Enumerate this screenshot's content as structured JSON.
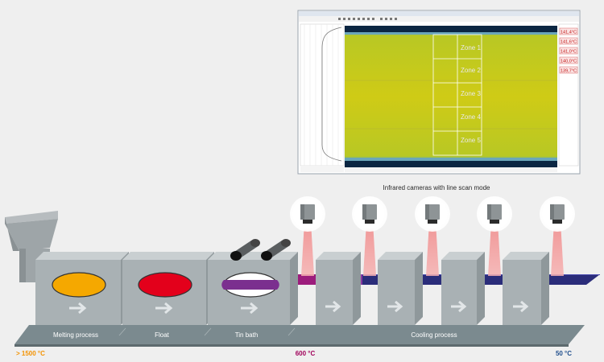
{
  "screen": {
    "zones": [
      "Zone 1",
      "Zone 2",
      "Zone 3",
      "Zone 4",
      "Zone 5"
    ],
    "readouts": [
      "141,4°C",
      "141,6°C",
      "141,0°C",
      "140,0°C",
      "139,7°C"
    ]
  },
  "caption": "Infrared cameras  with line scan mode",
  "stages": {
    "melting": "Melting process",
    "float": "Float",
    "tin": "Tin bath",
    "cooling": "Cooling  process"
  },
  "temps": {
    "hot": "> 1500 °C",
    "mid": "600 °C",
    "cold": "50 °C"
  },
  "colors": {
    "melt": "#f5a800",
    "float": "#e3001b",
    "tin": "#7b2f8f",
    "glass": "#2b2d7a",
    "hot_temp": "#f39200",
    "mid_temp": "#a0005a",
    "cold_temp": "#1f4e8c",
    "thermal": "#c9c814"
  }
}
